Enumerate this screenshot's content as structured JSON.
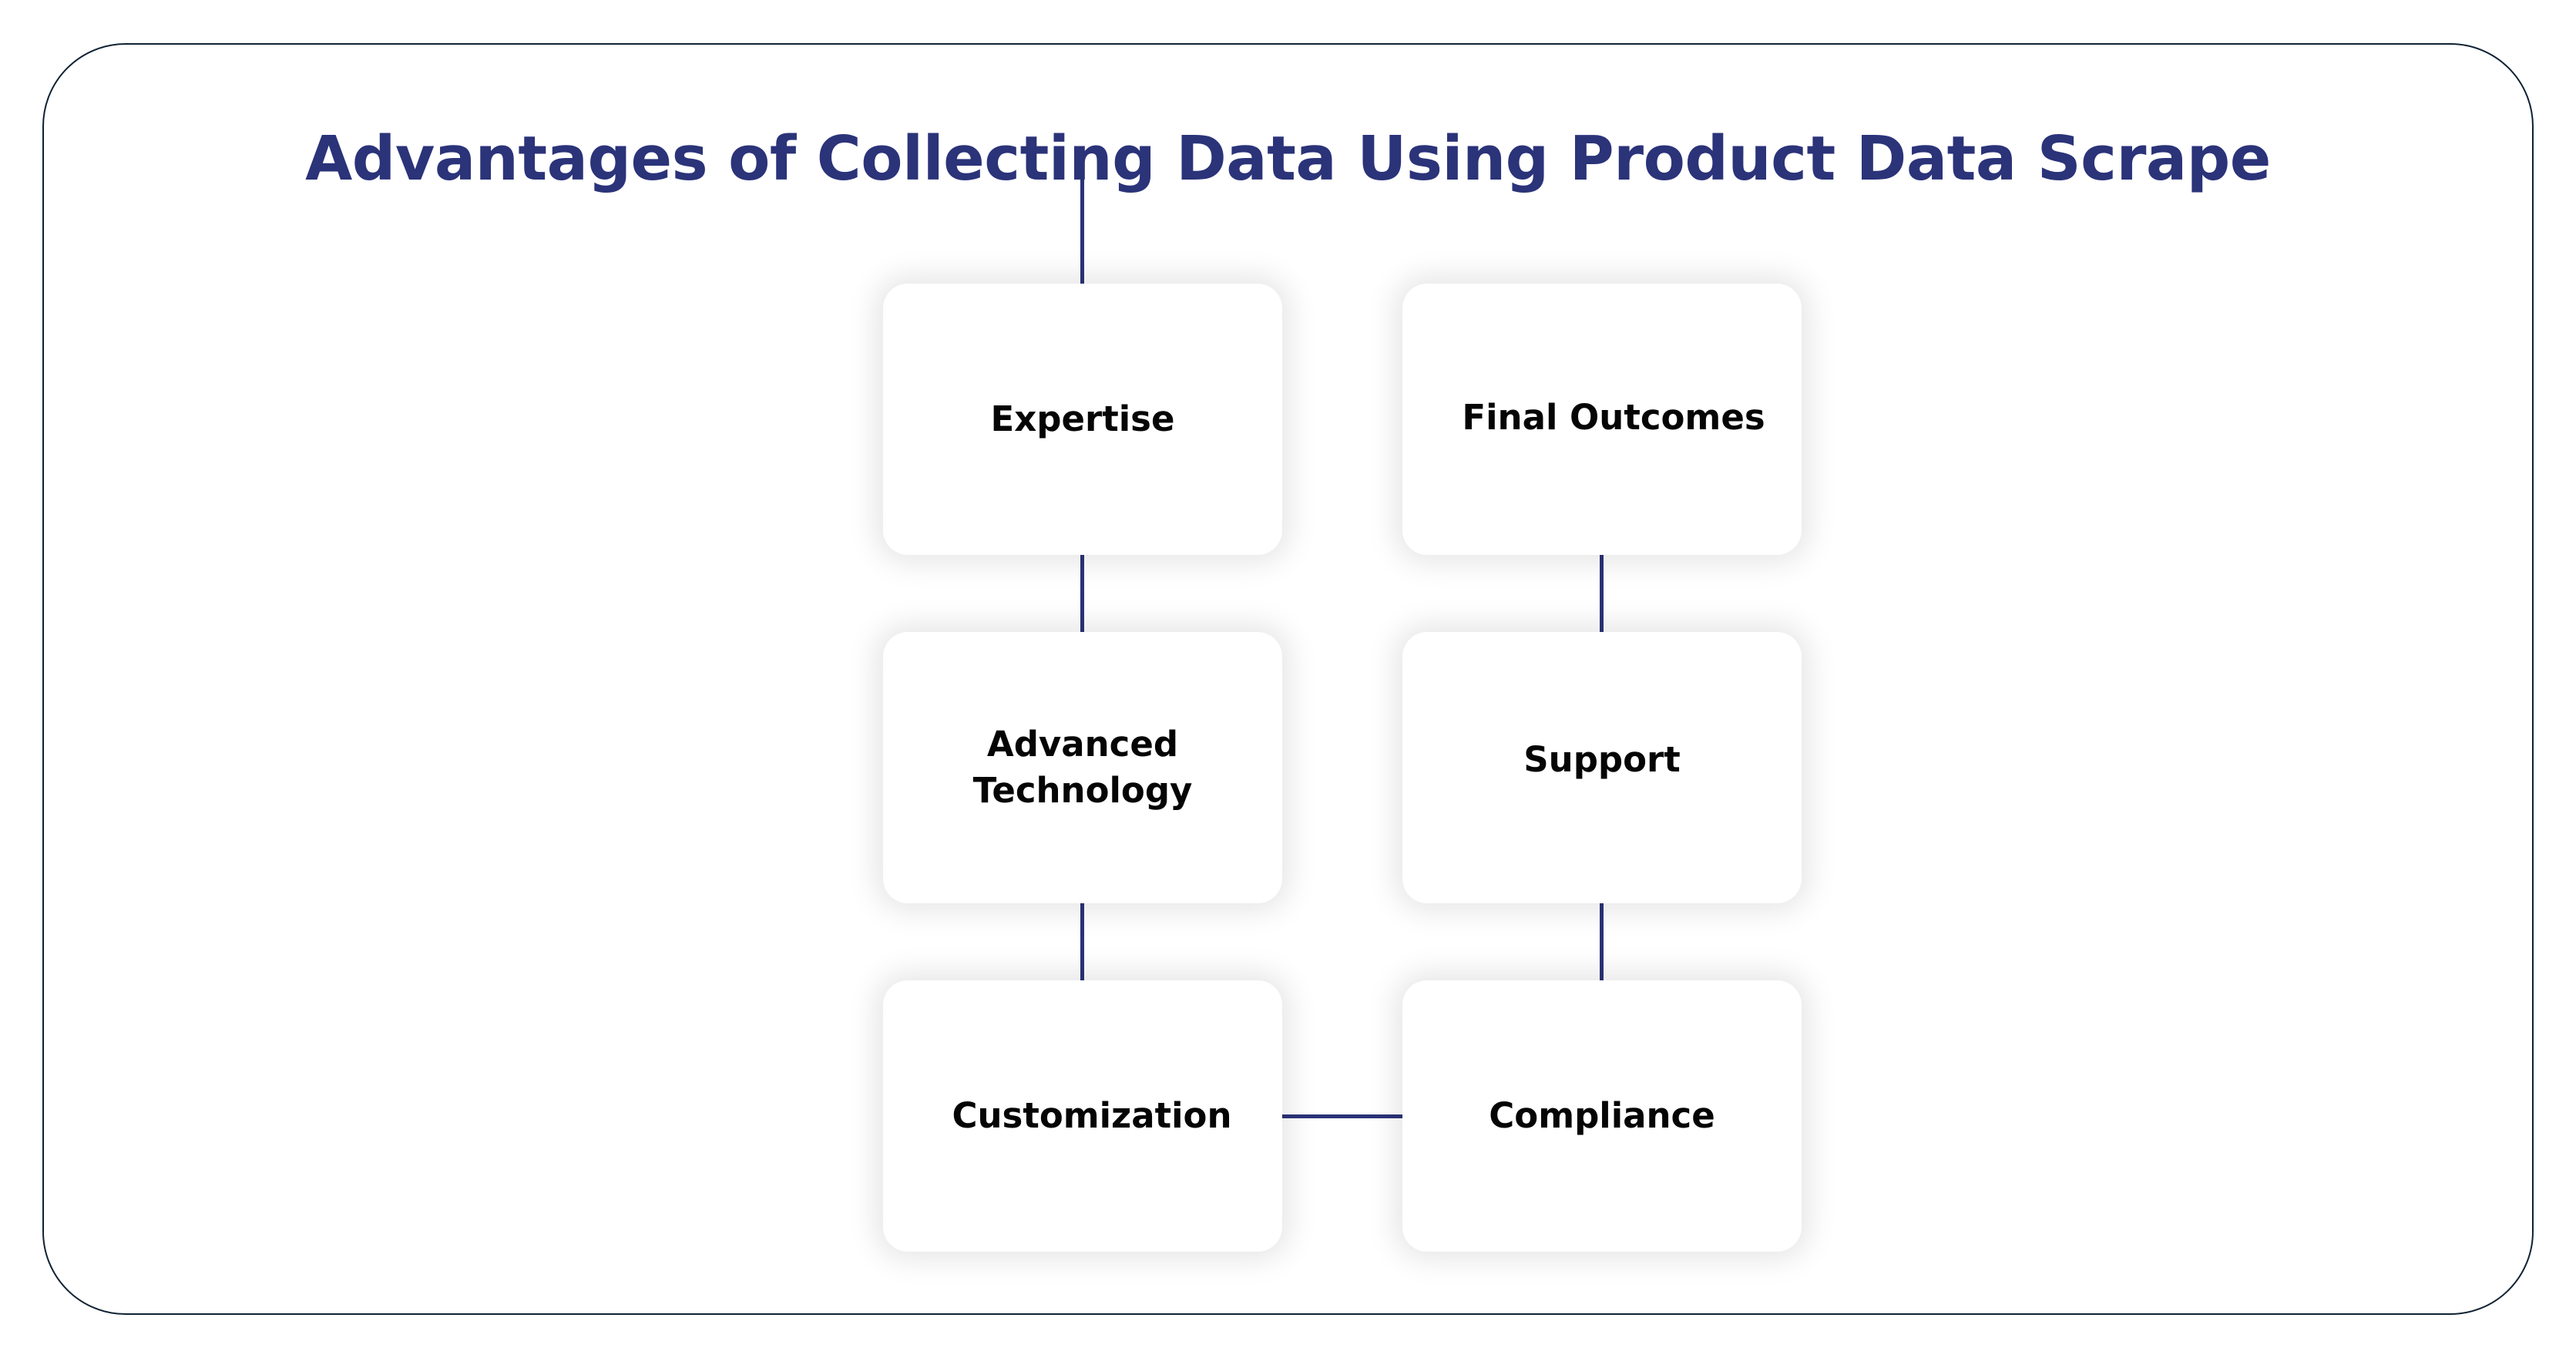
{
  "title": "Advantages of Collecting Data Using Product Data Scrape",
  "colors": {
    "title": "#2b3379",
    "connector": "#2b3378",
    "frame_border": "#0f2233",
    "card_background": "#ffffff",
    "label_text": "#050505"
  },
  "nodes": [
    {
      "id": "expertise",
      "label": "Expertise"
    },
    {
      "id": "advanced-technology",
      "label": "Advanced\nTechnology"
    },
    {
      "id": "customization",
      "label": "Customization"
    },
    {
      "id": "compliance",
      "label": "Compliance"
    },
    {
      "id": "support",
      "label": "Support"
    },
    {
      "id": "final-outcomes",
      "label": "Final Outcomes"
    }
  ],
  "edges": [
    {
      "from": "title",
      "to": "expertise"
    },
    {
      "from": "expertise",
      "to": "advanced-technology"
    },
    {
      "from": "advanced-technology",
      "to": "customization"
    },
    {
      "from": "customization",
      "to": "compliance"
    },
    {
      "from": "compliance",
      "to": "support"
    },
    {
      "from": "support",
      "to": "final-outcomes"
    }
  ]
}
